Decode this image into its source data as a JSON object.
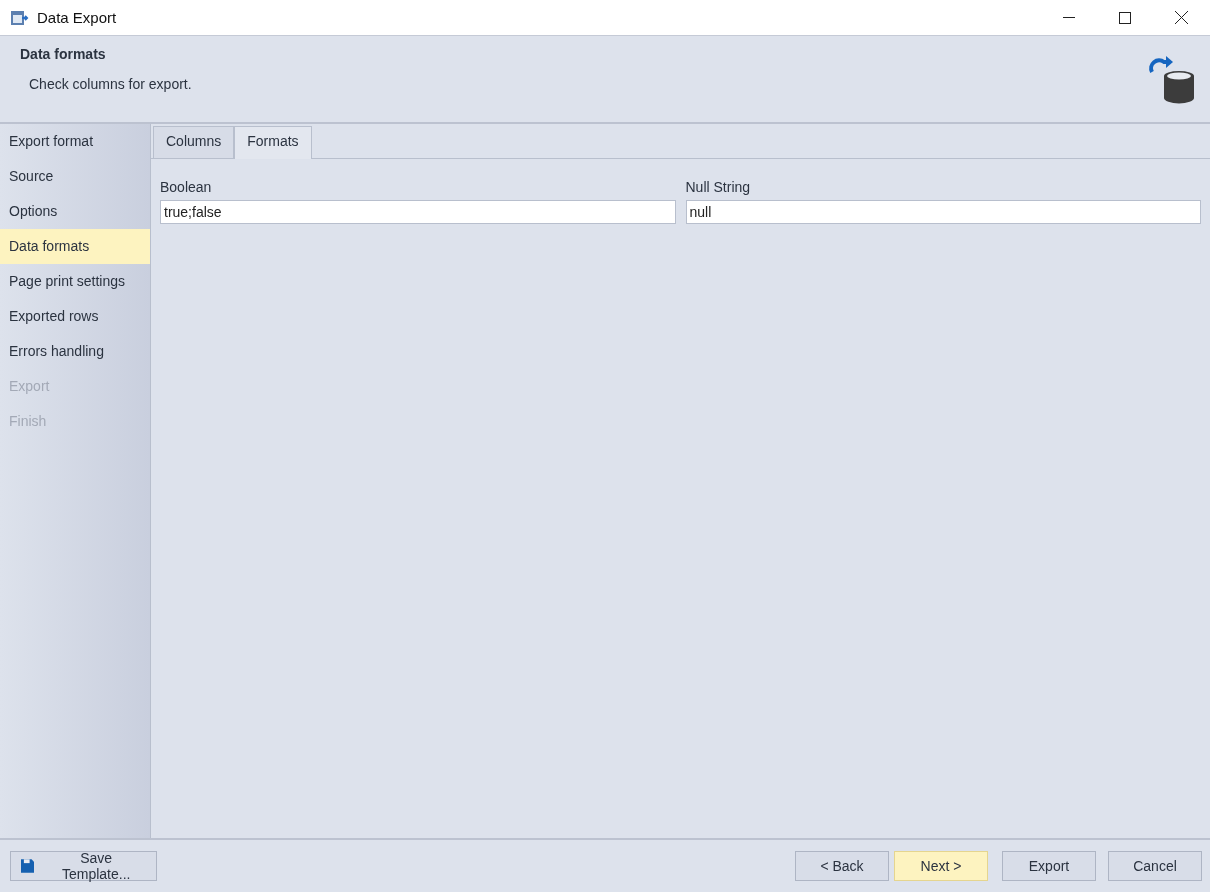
{
  "window": {
    "title": "Data Export"
  },
  "header": {
    "title": "Data formats",
    "subtitle": "Check columns for export."
  },
  "sidebar": {
    "items": [
      {
        "label": "Export format",
        "selected": false,
        "disabled": false
      },
      {
        "label": "Source",
        "selected": false,
        "disabled": false
      },
      {
        "label": "Options",
        "selected": false,
        "disabled": false
      },
      {
        "label": "Data formats",
        "selected": true,
        "disabled": false
      },
      {
        "label": "Page print settings",
        "selected": false,
        "disabled": false
      },
      {
        "label": "Exported rows",
        "selected": false,
        "disabled": false
      },
      {
        "label": "Errors handling",
        "selected": false,
        "disabled": false
      },
      {
        "label": "Export",
        "selected": false,
        "disabled": true
      },
      {
        "label": "Finish",
        "selected": false,
        "disabled": true
      }
    ]
  },
  "tabs": [
    {
      "label": "Columns",
      "selected": false
    },
    {
      "label": "Formats",
      "selected": true
    }
  ],
  "fields": [
    {
      "label": "Boolean",
      "value": "true;false"
    },
    {
      "label": "Null String",
      "value": "null"
    }
  ],
  "footer": {
    "left_button": "Save Template...",
    "buttons": [
      {
        "label": "< Back",
        "highlighted": false
      },
      {
        "label": "Next >",
        "highlighted": true
      },
      {
        "label": "Export",
        "highlighted": false
      },
      {
        "label": "Cancel",
        "highlighted": false
      }
    ]
  }
}
